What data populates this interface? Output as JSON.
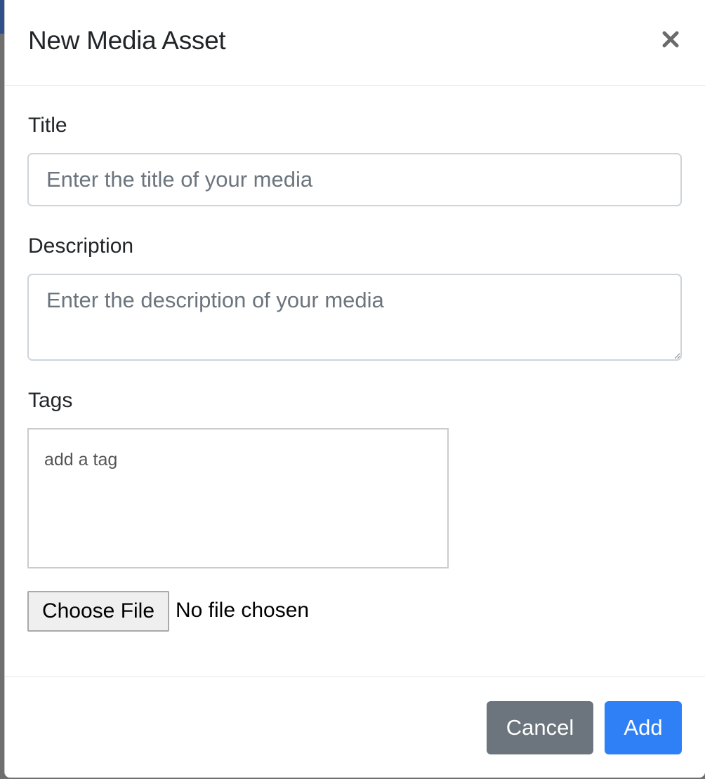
{
  "modal": {
    "title": "New Media Asset",
    "close_icon": "close-icon"
  },
  "form": {
    "title": {
      "label": "Title",
      "placeholder": "Enter the title of your media",
      "value": ""
    },
    "description": {
      "label": "Description",
      "placeholder": "Enter the description of your media",
      "value": ""
    },
    "tags": {
      "label": "Tags",
      "placeholder": "add a tag"
    },
    "file": {
      "button_label": "Choose File",
      "status": "No file chosen"
    }
  },
  "footer": {
    "cancel_label": "Cancel",
    "add_label": "Add"
  },
  "colors": {
    "primary": "#2f80f6",
    "secondary": "#6c757d",
    "backdrop_accent": "#2e4f8a"
  }
}
